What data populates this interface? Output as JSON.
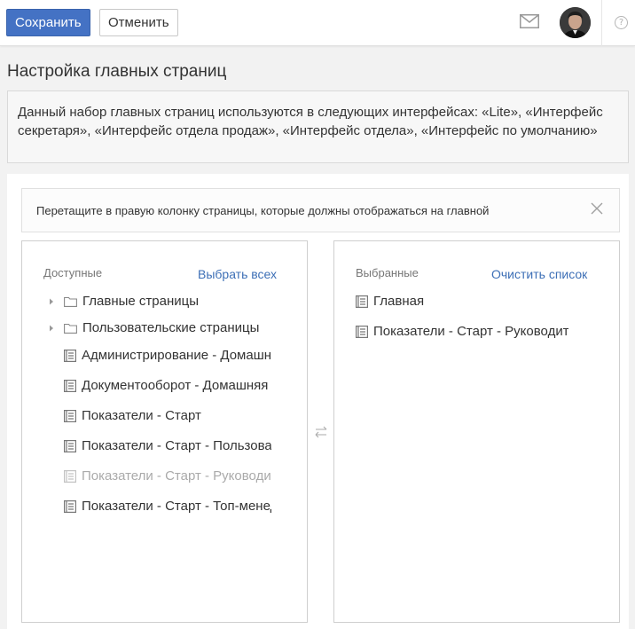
{
  "toolbar": {
    "save_label": "Сохранить",
    "cancel_label": "Отменить"
  },
  "page": {
    "title": "Настройка главных страниц",
    "info": "Данный набор главных страниц используются в следующих интерфейсах: «Lite», «Интерфейс секретаря», «Интерфейс отдела продаж», «Интерфейс отдела», «Интерфейс по умолчанию»"
  },
  "hint": {
    "text": "Перетащите в правую колонку страницы, которые должны отображаться на главной"
  },
  "available": {
    "heading": "Доступные",
    "action": "Выбрать всех",
    "items": [
      {
        "label": "Главные страницы",
        "kind": "folder"
      },
      {
        "label": "Пользовательские страницы",
        "kind": "folder"
      },
      {
        "label": "Администрирование - Домашняя",
        "kind": "page"
      },
      {
        "label": "Документооборот - Домашняя",
        "kind": "page"
      },
      {
        "label": "Показатели - Старт",
        "kind": "page"
      },
      {
        "label": "Показатели - Старт - Пользователь",
        "kind": "page"
      },
      {
        "label": "Показатели - Старт - Руководитель",
        "kind": "page",
        "disabled": true
      },
      {
        "label": "Показатели - Старт - Топ-менеджер",
        "kind": "page"
      }
    ]
  },
  "selected": {
    "heading": "Выбранные",
    "action": "Очистить список",
    "items": [
      {
        "label": "Главная",
        "kind": "page"
      },
      {
        "label": "Показатели - Старт - Руководитель",
        "kind": "page"
      }
    ]
  },
  "icons": {
    "mail": "mail-icon",
    "help": "help-icon",
    "help_glyph": "?",
    "close": "close-icon",
    "swap": "swap-arrows-icon",
    "folder": "folder-icon",
    "page": "page-icon",
    "caret": "caret-right-icon"
  },
  "colors": {
    "accent": "#4472c4",
    "link": "#3d6fb6"
  }
}
